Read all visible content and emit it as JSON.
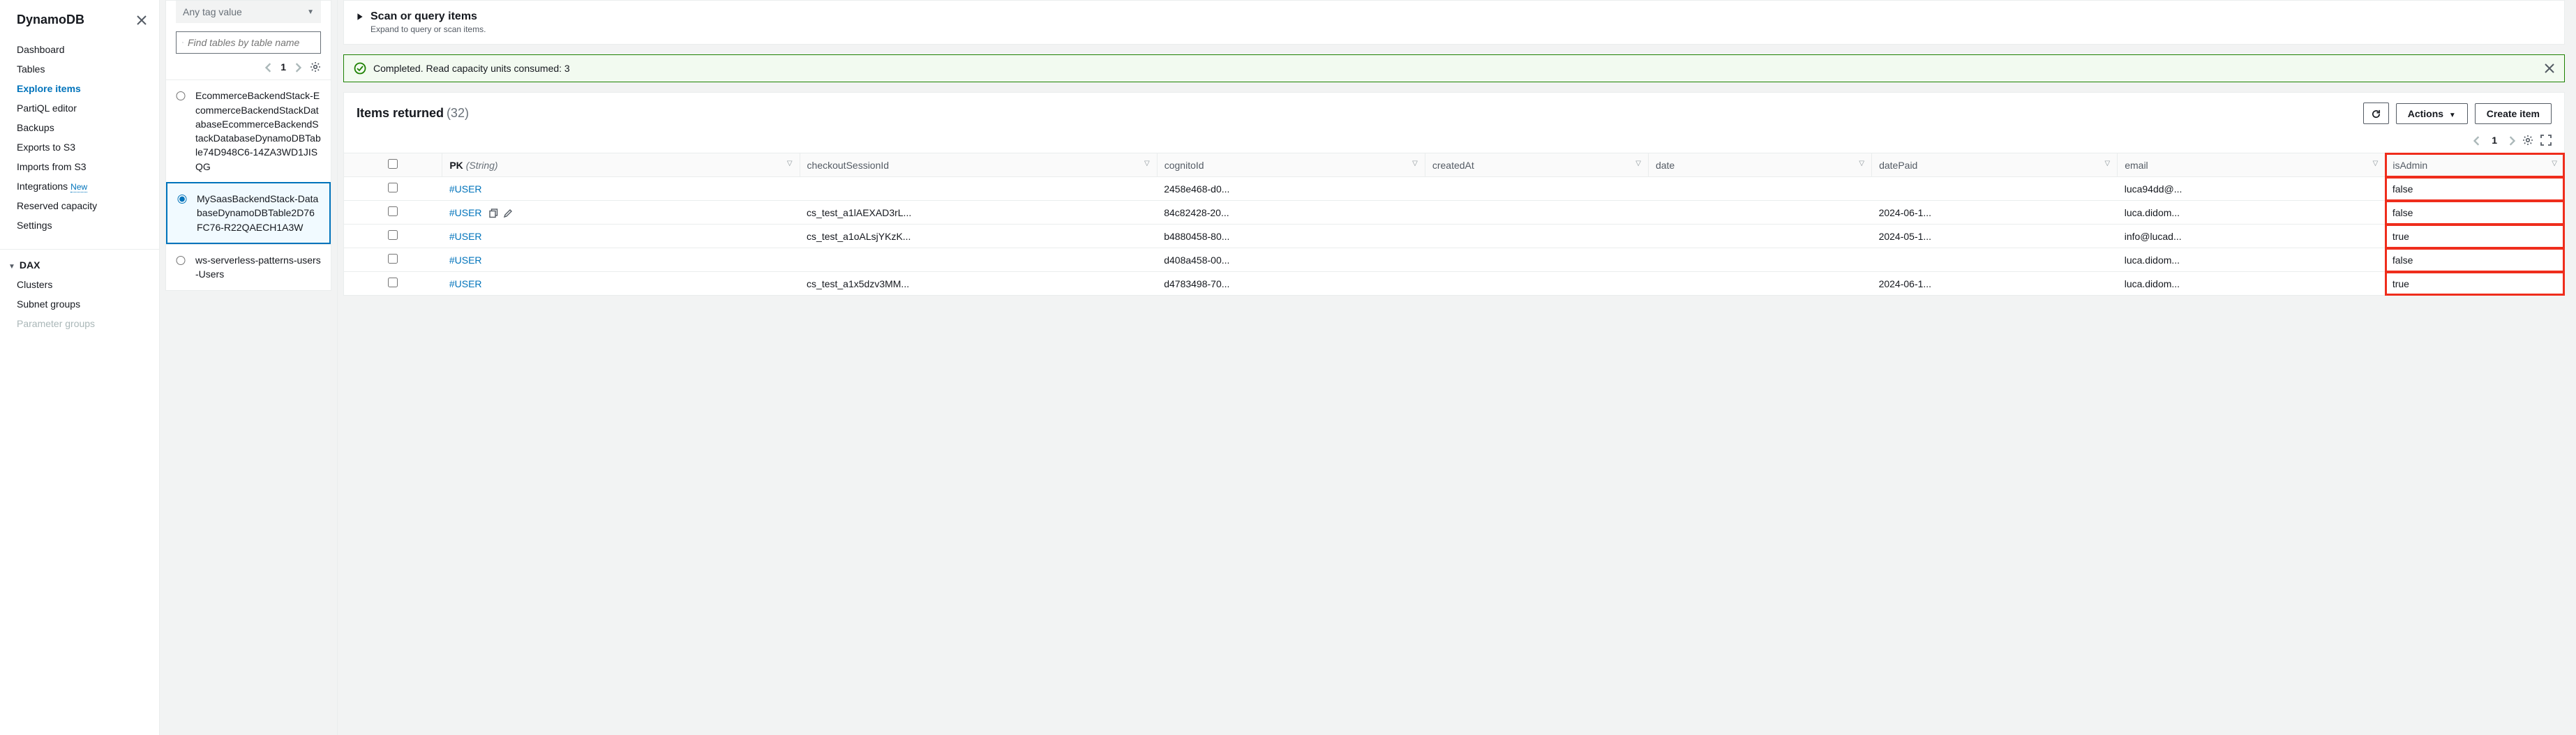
{
  "sidebar": {
    "title": "DynamoDB",
    "items": [
      {
        "label": "Dashboard",
        "active": false
      },
      {
        "label": "Tables",
        "active": false
      },
      {
        "label": "Explore items",
        "active": true
      },
      {
        "label": "PartiQL editor",
        "active": false
      },
      {
        "label": "Backups",
        "active": false
      },
      {
        "label": "Exports to S3",
        "active": false
      },
      {
        "label": "Imports from S3",
        "active": false
      },
      {
        "label": "Integrations",
        "active": false,
        "badge": "New"
      },
      {
        "label": "Reserved capacity",
        "active": false
      },
      {
        "label": "Settings",
        "active": false
      }
    ],
    "dax": {
      "title": "DAX",
      "items": [
        {
          "label": "Clusters"
        },
        {
          "label": "Subnet groups"
        },
        {
          "label": "Parameter groups"
        }
      ]
    }
  },
  "tablesPanel": {
    "filter_placeholder_tag": "Any tag value",
    "search_placeholder": "Find tables by table name",
    "page": "1",
    "tables": [
      {
        "name": "EcommerceBackendStack-EcommerceBackendStackDatabaseEcommerceBackendStackDatabaseDynamoDBTable74D948C6-14ZA3WD1JISQG",
        "selected": false
      },
      {
        "name": "MySaasBackendStack-DatabaseDynamoDBTable2D76FC76-R22QAECH1A3W",
        "selected": true
      },
      {
        "name": "ws-serverless-patterns-users-Users",
        "selected": false
      }
    ]
  },
  "scanPanel": {
    "title": "Scan or query items",
    "subtitle": "Expand to query or scan items."
  },
  "alert": {
    "text": "Completed. Read capacity units consumed: 3"
  },
  "itemsPanel": {
    "title": "Items returned",
    "count": "(32)",
    "page": "1",
    "refresh_icon": "refresh",
    "actions_label": "Actions",
    "create_label": "Create item",
    "columns": {
      "pk_label": "PK",
      "pk_type": "(String)",
      "checkoutSessionId": "checkoutSessionId",
      "cognitoId": "cognitoId",
      "createdAt": "createdAt",
      "date": "date",
      "datePaid": "datePaid",
      "email": "email",
      "isAdmin": "isAdmin"
    },
    "rows": [
      {
        "pk": "#USER",
        "cs": "",
        "cognito": "2458e468-d0...",
        "createdAt": "",
        "date": "",
        "datePaid": "",
        "email": "luca94dd@...",
        "isAdmin": "false",
        "hover": false
      },
      {
        "pk": "#USER",
        "cs": "cs_test_a1lAEXAD3rL...",
        "cognito": "84c82428-20...",
        "createdAt": "",
        "date": "",
        "datePaid": "2024-06-1...",
        "email": "luca.didom...",
        "isAdmin": "false",
        "hover": true
      },
      {
        "pk": "#USER",
        "cs": "cs_test_a1oALsjYKzK...",
        "cognito": "b4880458-80...",
        "createdAt": "",
        "date": "",
        "datePaid": "2024-05-1...",
        "email": "info@lucad...",
        "isAdmin": "true",
        "hover": false
      },
      {
        "pk": "#USER",
        "cs": "",
        "cognito": "d408a458-00...",
        "createdAt": "",
        "date": "",
        "datePaid": "",
        "email": "luca.didom...",
        "isAdmin": "false",
        "hover": false
      },
      {
        "pk": "#USER",
        "cs": "cs_test_a1x5dzv3MM...",
        "cognito": "d4783498-70...",
        "createdAt": "",
        "date": "",
        "datePaid": "2024-06-1...",
        "email": "luca.didom...",
        "isAdmin": "true",
        "hover": false
      }
    ]
  }
}
